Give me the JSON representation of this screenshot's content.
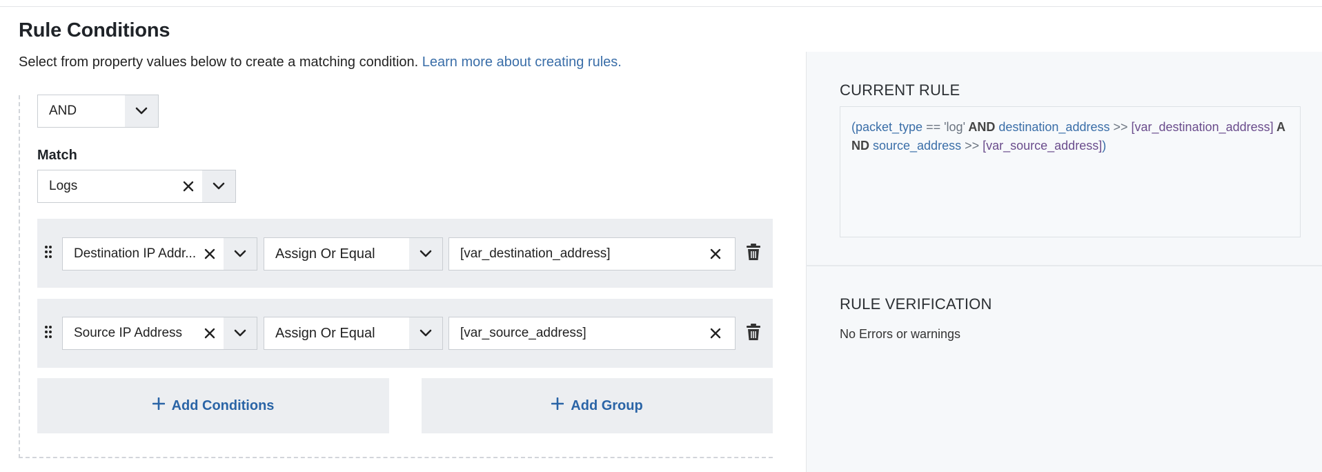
{
  "header": {
    "title": "Rule Conditions",
    "subtitle": "Select from property values below to create a matching condition.",
    "learn_more": "Learn more about creating rules."
  },
  "group": {
    "operator": "AND",
    "match_label": "Match",
    "match_value": "Logs"
  },
  "conditions": [
    {
      "field": "Destination IP Addr...",
      "operator": "Assign Or Equal",
      "value": "[var_destination_address]"
    },
    {
      "field": "Source IP Address",
      "operator": "Assign Or Equal",
      "value": "[var_source_address]"
    }
  ],
  "actions": {
    "add_conditions": "Add Conditions",
    "add_group": "Add Group"
  },
  "current_rule": {
    "title": "CURRENT RULE",
    "tokens": [
      {
        "t": "par",
        "v": "("
      },
      {
        "t": "key",
        "v": "packet_type"
      },
      {
        "t": "op",
        "v": " == "
      },
      {
        "t": "str",
        "v": "'log'"
      },
      {
        "t": "and",
        "v": " AND "
      },
      {
        "t": "key",
        "v": "destination_address"
      },
      {
        "t": "op",
        "v": " >> "
      },
      {
        "t": "var",
        "v": "[var_destination_address]"
      },
      {
        "t": "and",
        "v": " AND "
      },
      {
        "t": "key",
        "v": "source_address"
      },
      {
        "t": "op",
        "v": " >> "
      },
      {
        "t": "var",
        "v": "[var_source_address]"
      },
      {
        "t": "par",
        "v": ")"
      }
    ]
  },
  "verification": {
    "title": "RULE VERIFICATION",
    "message": "No Errors or warnings"
  },
  "colors": {
    "link": "#3a6ea8",
    "action": "#2a64a6",
    "panel_bg": "#eceef1",
    "right_bg": "#f6f8fa"
  },
  "icons": {
    "clear": "close-icon",
    "caret": "chevron-down-icon",
    "drag": "drag-handle-icon",
    "delete": "trash-icon",
    "add": "plus-icon"
  }
}
